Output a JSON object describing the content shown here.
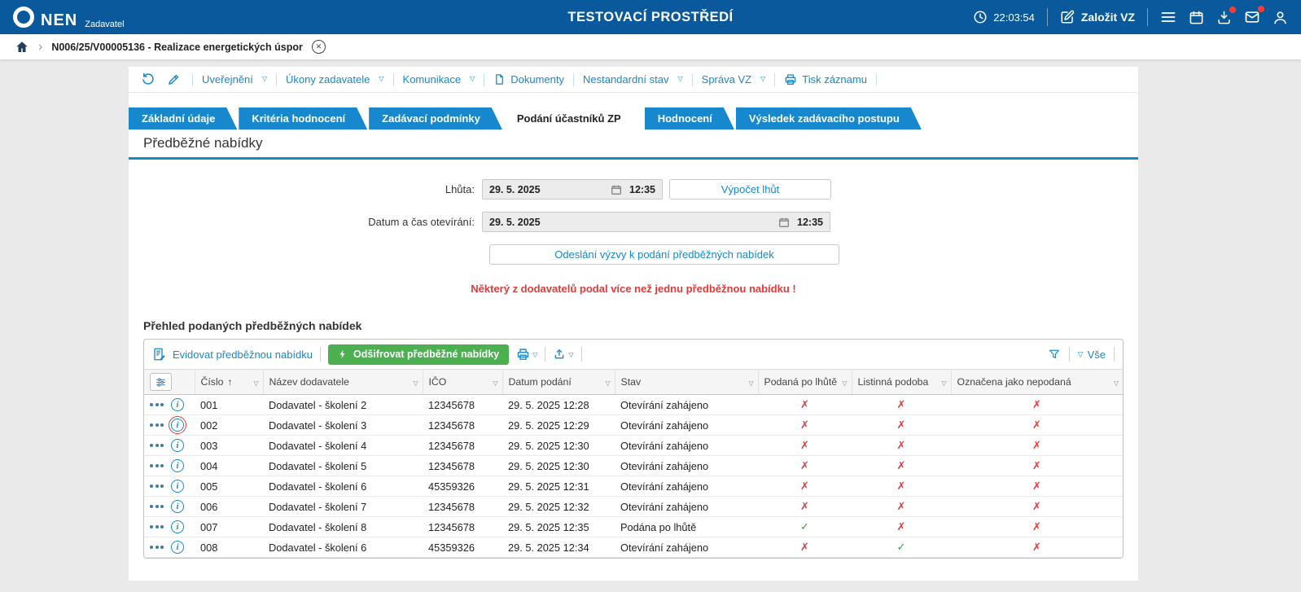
{
  "colors": {
    "header_bg": "#0a599c",
    "accent_blue": "#1787ce",
    "green": "#4caf50",
    "red": "#e23b3b",
    "warning_red": "#e03a3a"
  },
  "icons": {
    "check": "✓",
    "cross": "✗",
    "caret": "▽",
    "sort_asc": "↑",
    "breadcrumb_chevron": "›"
  },
  "header": {
    "brand": "NEN",
    "brand_sub": "Zadavatel",
    "title": "TESTOVACÍ PROSTŘEDÍ",
    "time": "22:03:54",
    "create_vz": "Založit VZ"
  },
  "breadcrumb": {
    "item": "N006/25/V00005136 - Realizace energetických úspor"
  },
  "toolbar": {
    "items": [
      {
        "label": "Uveřejnění",
        "dropdown": true
      },
      {
        "label": "Úkony zadavatele",
        "dropdown": true
      },
      {
        "label": "Komunikace",
        "dropdown": true
      },
      {
        "label": "Dokumenty",
        "dropdown": false
      },
      {
        "label": "Nestandardní stav",
        "dropdown": true
      },
      {
        "label": "Správa VZ",
        "dropdown": true
      },
      {
        "label": "Tisk záznamu",
        "dropdown": false
      }
    ]
  },
  "tabs": [
    {
      "label": "Základní údaje",
      "active": false
    },
    {
      "label": "Kritéria hodnocení",
      "active": false
    },
    {
      "label": "Zadávací podmínky",
      "active": false
    },
    {
      "label": "Podání účastníků ZP",
      "active": true
    },
    {
      "label": "Hodnocení",
      "active": false
    },
    {
      "label": "Výsledek zadávacího postupu",
      "active": false
    }
  ],
  "section": {
    "title": "Předběžné nabídky",
    "deadline_label": "Lhůta:",
    "deadline_date": "29. 5. 2025",
    "deadline_time": "12:35",
    "calc_button": "Výpočet lhůt",
    "opening_label": "Datum a čas otevírání:",
    "opening_date": "29. 5. 2025",
    "opening_time": "12:35",
    "send_button": "Odeslání výzvy k podání předběžných nabídek",
    "warning": "Některý z dodavatelů podal více než jednu předběžnou nabídku !"
  },
  "grid": {
    "title": "Přehled podaných předběžných nabídek",
    "toolbar": {
      "register": "Evidovat předběžnou nabídku",
      "decrypt": "Odšifrovat předběžné nabídky",
      "all_filter": "Vše"
    },
    "columns": [
      "Číslo",
      "Název dodavatele",
      "IČO",
      "Datum podání",
      "Stav",
      "Podaná po lhůtě",
      "Listinná podoba",
      "Označena jako nepodaná"
    ],
    "rows": [
      {
        "cislo": "001",
        "nazev": "Dodavatel - školení 2",
        "ico": "12345678",
        "datum": "29. 5. 2025 12:28",
        "stav": "Otevírání zahájeno",
        "po_lhute": false,
        "listinna": false,
        "nepodana": false,
        "info_highlight": false
      },
      {
        "cislo": "002",
        "nazev": "Dodavatel - školení 3",
        "ico": "12345678",
        "datum": "29. 5. 2025 12:29",
        "stav": "Otevírání zahájeno",
        "po_lhute": false,
        "listinna": false,
        "nepodana": false,
        "info_highlight": true
      },
      {
        "cislo": "003",
        "nazev": "Dodavatel - školení 4",
        "ico": "12345678",
        "datum": "29. 5. 2025 12:30",
        "stav": "Otevírání zahájeno",
        "po_lhute": false,
        "listinna": false,
        "nepodana": false,
        "info_highlight": false
      },
      {
        "cislo": "004",
        "nazev": "Dodavatel - školení 5",
        "ico": "12345678",
        "datum": "29. 5. 2025 12:30",
        "stav": "Otevírání zahájeno",
        "po_lhute": false,
        "listinna": false,
        "nepodana": false,
        "info_highlight": false
      },
      {
        "cislo": "005",
        "nazev": "Dodavatel - školení 6",
        "ico": "45359326",
        "datum": "29. 5. 2025 12:31",
        "stav": "Otevírání zahájeno",
        "po_lhute": false,
        "listinna": false,
        "nepodana": false,
        "info_highlight": false
      },
      {
        "cislo": "006",
        "nazev": "Dodavatel - školení 7",
        "ico": "12345678",
        "datum": "29. 5. 2025 12:32",
        "stav": "Otevírání zahájeno",
        "po_lhute": false,
        "listinna": false,
        "nepodana": false,
        "info_highlight": false
      },
      {
        "cislo": "007",
        "nazev": "Dodavatel - školení 8",
        "ico": "12345678",
        "datum": "29. 5. 2025 12:35",
        "stav": "Podána po lhůtě",
        "po_lhute": true,
        "listinna": false,
        "nepodana": false,
        "info_highlight": false
      },
      {
        "cislo": "008",
        "nazev": "Dodavatel - školení 6",
        "ico": "45359326",
        "datum": "29. 5. 2025 12:34",
        "stav": "Otevírání zahájeno",
        "po_lhute": false,
        "listinna": true,
        "nepodana": false,
        "info_highlight": false
      }
    ]
  }
}
